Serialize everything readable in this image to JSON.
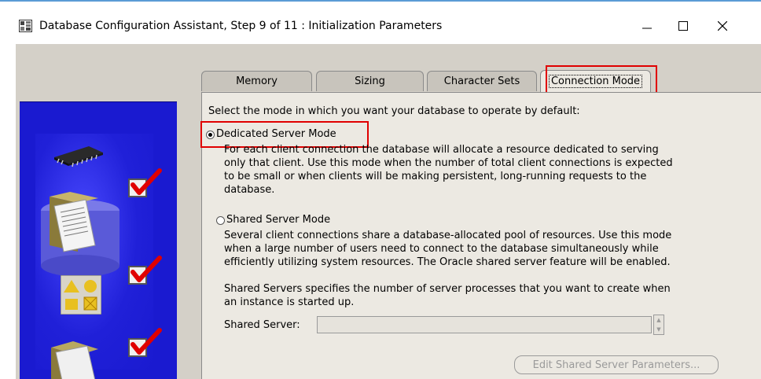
{
  "window": {
    "title": "Database Configuration Assistant, Step 9 of 11 : Initialization Parameters",
    "app_icon": "database-grid-icon",
    "controls": {
      "minimize": "—",
      "maximize": "☐",
      "close": "✕"
    }
  },
  "tabs": [
    {
      "label": "Memory",
      "active": false
    },
    {
      "label": "Sizing",
      "active": false
    },
    {
      "label": "Character Sets",
      "active": false
    },
    {
      "label": "Connection Mode",
      "active": true
    }
  ],
  "panel": {
    "intro": "Select the mode in which you want your database to operate by default:",
    "dedicated": {
      "label": "Dedicated Server Mode",
      "selected": true,
      "description": [
        "For each client connection the database will allocate a resource dedicated to serving",
        "only that client.  Use this mode when the number of total client connections is expected",
        "to be small or when clients will be making persistent, long-running requests to the",
        "database."
      ]
    },
    "shared": {
      "label": "Shared Server Mode",
      "selected": false,
      "description": [
        "Several client connections share a database-allocated pool of resources.  Use this mode",
        "when a large number of users need to connect to the database simultaneously while",
        "efficiently utilizing system resources.  The Oracle shared server feature will be enabled."
      ],
      "servers_note": [
        "Shared Servers specifies the number of server processes that you want to create when",
        "an instance is started up."
      ],
      "field_label": "Shared Server:",
      "field_value": "",
      "edit_button": "Edit Shared Server Parameters..."
    }
  },
  "side_panel": {
    "icons": [
      "memory-chip-icon",
      "document-folder-icon",
      "shapes-tile-icon",
      "folder-icon"
    ],
    "checks": [
      "red-checkmark-icon",
      "red-checkmark-icon",
      "red-checkmark-icon"
    ]
  },
  "colors": {
    "highlight": "#e00000",
    "side_panel": "#1a1ad0",
    "dialog_bg": "#d4d0c8",
    "panel_bg": "#ece9e2"
  }
}
